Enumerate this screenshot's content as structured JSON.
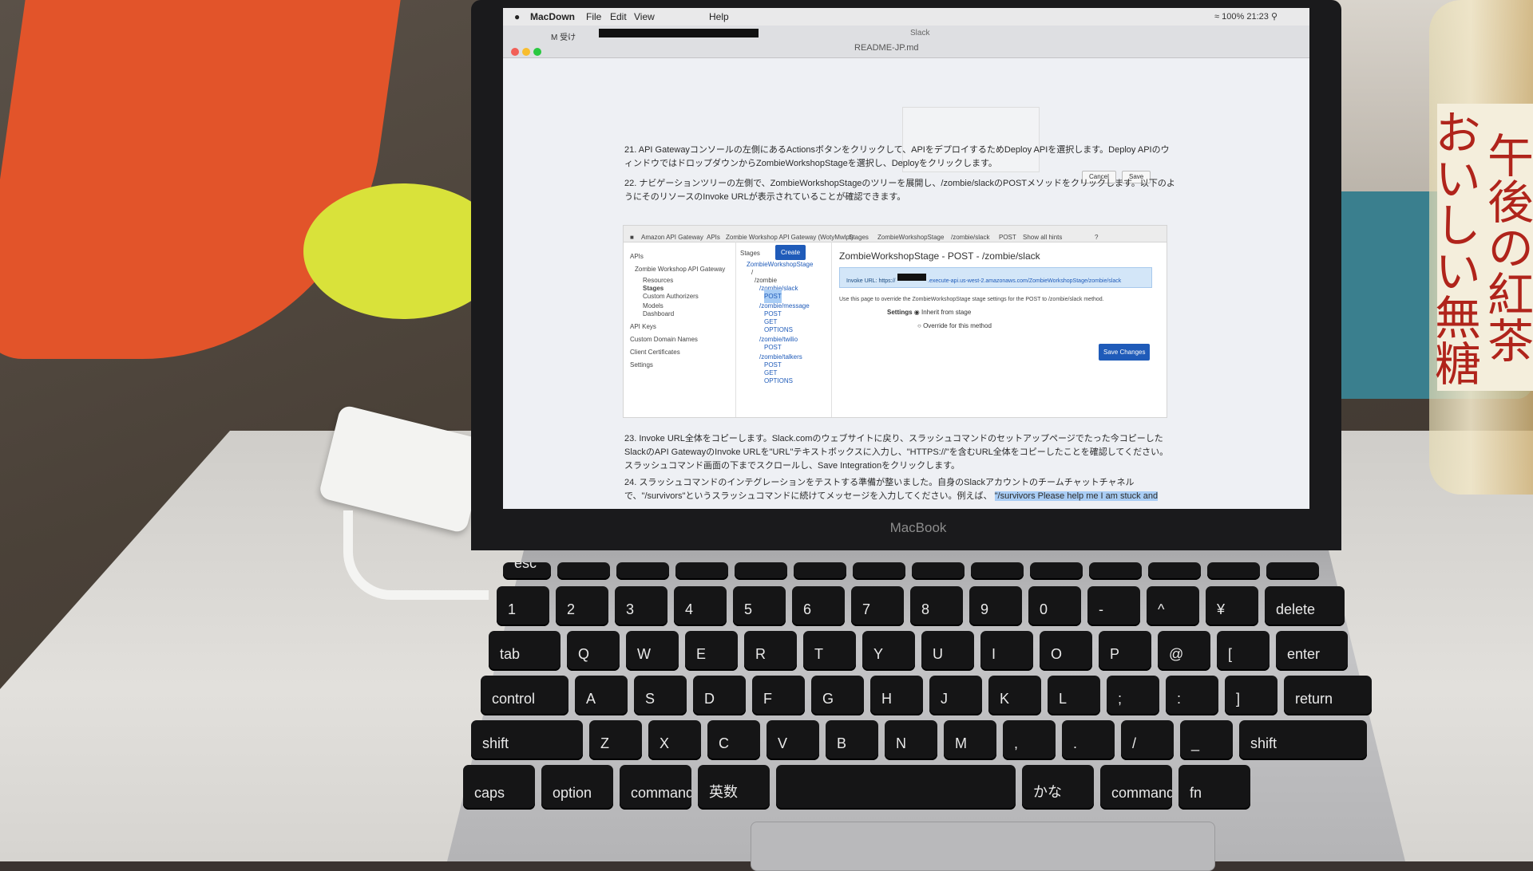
{
  "macos": {
    "menu": [
      "MacDown",
      "File",
      "Edit",
      "View",
      "Help"
    ],
    "battery": "100%",
    "clock": "21:23",
    "window_title": "README-JP.md",
    "browser_tab": "受け",
    "slack_title": "Slack"
  },
  "doc": {
    "cancel_label": "Cancel",
    "save_label": "Save",
    "step21": "21. API Gatewayコンソールの左側にあるActionsボタンをクリックして、APIをデプロイするためDeploy APIを選択します。Deploy APIのウィンドウではドロップダウンからZombieWorkshopStageを選択し、Deployをクリックします。",
    "step22": "22. ナビゲーションツリーの左側で、ZombieWorkshopStageのツリーを展開し、/zombie/slackのPOSTメソッドをクリックします。以下のようにそのリソースのInvoke URLが表示されていることが確認できます。",
    "step23": "23. Invoke URL全体をコピーします。Slack.comのウェブサイトに戻り、スラッシュコマンドのセットアップページでたった今コピーしたSlackのAPI GatewayのInvoke URLを\"URL\"テキストボックスに入力し、\"HTTPS://\"を含むURL全体をコピーしたことを確認してください。スラッシュコマンド画面の下までスクロールし、Save Integrationをクリックします。",
    "step24_a": "24. スラッシュコマンドのインテグレーションをテストする準備が整いました。自身のSlackアカウントのチームチャットチャネルで、\"/survivors\"というスラッシュコマンドに続けてメッセージを入力してください。例えば、",
    "step24_b": "\"/survivors Please help me I am stuck and"
  },
  "console": {
    "crumbs": [
      "Amazon API Gateway",
      "APIs",
      "Zombie Workshop API Gateway (WotyMwlpI)",
      "Stages",
      "ZombieWorkshopStage",
      "/zombie/slack",
      "POST",
      "Show all hints"
    ],
    "nav": [
      "APIs",
      "Zombie Workshop API Gateway",
      "Resources",
      "Stages",
      "Custom Authorizers",
      "Models",
      "Dashboard",
      "API Keys",
      "Custom Domain Names",
      "Client Certificates",
      "Settings"
    ],
    "stages_label": "Stages",
    "create_label": "Create",
    "tree": [
      "ZombieWorkshopStage",
      "/",
      "/zombie",
      "/zombie/slack",
      "POST",
      "/zombie/message",
      "POST",
      "GET",
      "OPTIONS",
      "/zombie/twilio",
      "POST",
      "/zombie/talkers",
      "POST",
      "GET",
      "OPTIONS"
    ],
    "stage_title": "ZombieWorkshopStage - POST - /zombie/slack",
    "invoke_prefix": "Invoke URL: https://",
    "invoke_suffix": ".execute-api.us-west-2.amazonaws.com/ZombieWorkshopStage/zombie/slack",
    "override_text": "Use this page to override the ZombieWorkshopStage stage settings for the POST to /zombie/slack method.",
    "settings_label": "Settings",
    "opt_inherit": "Inherit from stage",
    "opt_override": "Override for this method",
    "save_changes": "Save Changes"
  },
  "laptop_brand": "MacBook",
  "bottle_label": "午後の紅茶 おいしい無糖",
  "keyboard": {
    "row1": [
      "esc",
      "",
      "",
      "",
      "",
      "",
      "",
      "",
      "",
      "",
      "",
      "",
      "",
      ""
    ],
    "row2": [
      "1",
      "2",
      "3",
      "4",
      "5",
      "6",
      "7",
      "8",
      "9",
      "0",
      "-",
      "^",
      "¥",
      "delete"
    ],
    "row3": [
      "tab",
      "Q",
      "W",
      "E",
      "R",
      "T",
      "Y",
      "U",
      "I",
      "O",
      "P",
      "@",
      "[",
      "enter"
    ],
    "row4": [
      "control",
      "A",
      "S",
      "D",
      "F",
      "G",
      "H",
      "J",
      "K",
      "L",
      ";",
      ":",
      "]",
      "return"
    ],
    "row5": [
      "shift",
      "Z",
      "X",
      "C",
      "V",
      "B",
      "N",
      "M",
      ",",
      ".",
      "/",
      "_",
      "shift"
    ],
    "row6": [
      "caps",
      "option",
      "command",
      "英数",
      "",
      "かな",
      "command",
      "fn"
    ]
  }
}
